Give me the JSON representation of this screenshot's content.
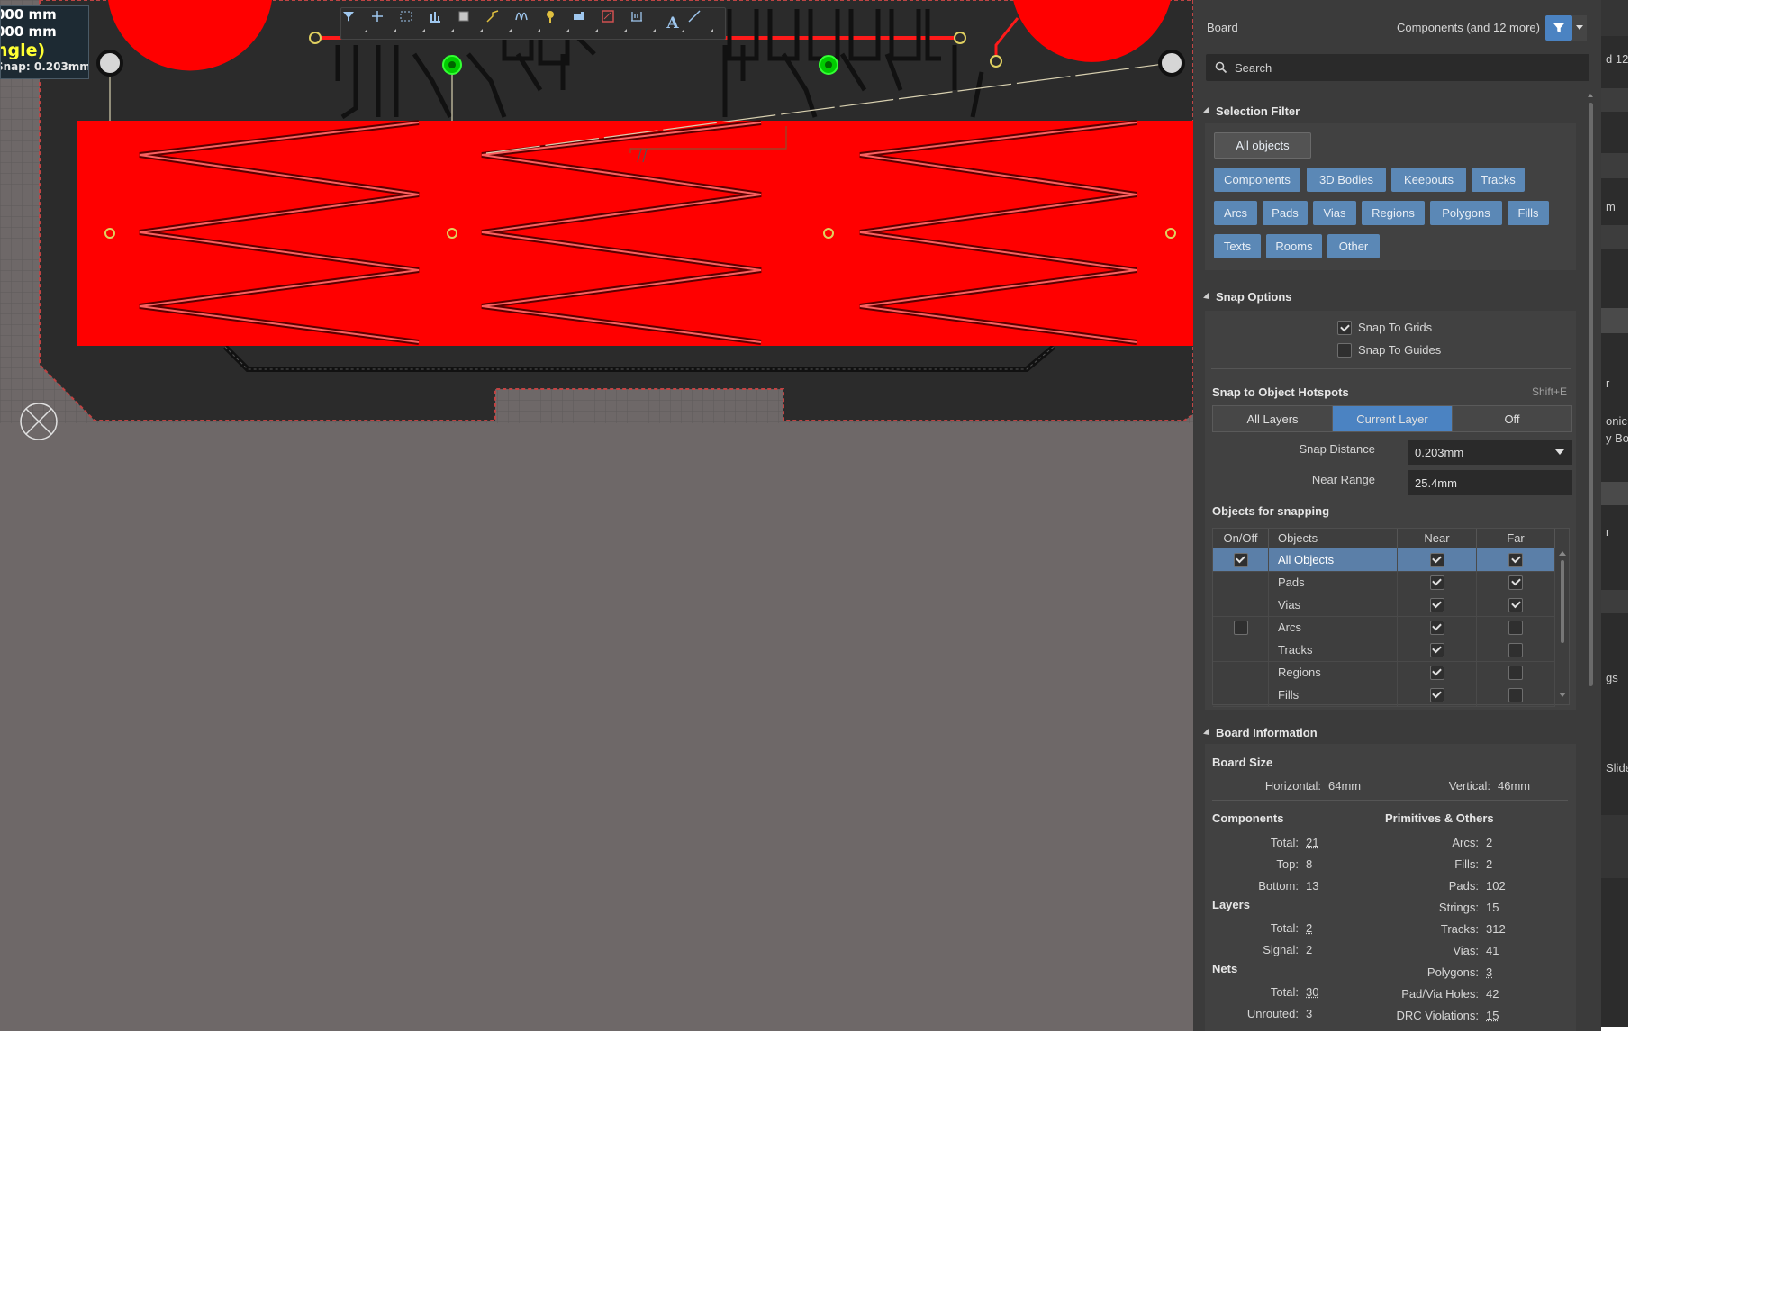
{
  "hud": {
    "line1": "000 mm",
    "line2": "000 mm",
    "line3": "ngle)",
    "snap": "Snap: 0.203mm"
  },
  "toolbar": {
    "tools": [
      "filter-icon",
      "cross-icon",
      "select-rect-icon",
      "align-icon",
      "component-icon",
      "route-icon",
      "tune-icon",
      "pin-icon",
      "fill-icon",
      "polygon-icon",
      "dimension-icon",
      "text-icon",
      "line-icon"
    ],
    "text_tool_glyph": "A"
  },
  "panel": {
    "title": "Board",
    "filter_summary": "Components (and 12 more)",
    "search_placeholder": "Search",
    "selection_filter": {
      "title": "Selection Filter",
      "all_label": "All objects",
      "chips": [
        "Components",
        "3D Bodies",
        "Keepouts",
        "Tracks",
        "Arcs",
        "Pads",
        "Vias",
        "Regions",
        "Polygons",
        "Fills",
        "Texts",
        "Rooms",
        "Other"
      ]
    },
    "snap_options": {
      "title": "Snap Options",
      "snap_to_grids": "Snap To Grids",
      "snap_to_grids_checked": true,
      "snap_to_guides": "Snap To Guides",
      "snap_to_guides_checked": false,
      "hotspots_title": "Snap to Object Hotspots",
      "hotspots_shortcut": "Shift+E",
      "layers_options": [
        "All Layers",
        "Current Layer",
        "Off"
      ],
      "layers_selected": "Current Layer",
      "snap_distance_label": "Snap Distance",
      "snap_distance_value": "0.203mm",
      "near_range_label": "Near Range",
      "near_range_value": "25.4mm",
      "objects_title": "Objects for snapping",
      "columns": [
        "On/Off",
        "Objects",
        "Near",
        "Far"
      ],
      "rows": [
        {
          "name": "All Objects",
          "on": true,
          "near": true,
          "far": true,
          "selected": true
        },
        {
          "name": "Pads",
          "on": null,
          "near": true,
          "far": true
        },
        {
          "name": "Vias",
          "on": null,
          "near": true,
          "far": true
        },
        {
          "name": "Arcs",
          "on": false,
          "near": true,
          "far": false
        },
        {
          "name": "Tracks",
          "on": null,
          "near": true,
          "far": false
        },
        {
          "name": "Regions",
          "on": null,
          "near": true,
          "far": false
        },
        {
          "name": "Fills",
          "on": null,
          "near": true,
          "far": false
        }
      ]
    },
    "board_info": {
      "title": "Board Information",
      "board_size_title": "Board Size",
      "horizontal_label": "Horizontal:",
      "horizontal_value": "64mm",
      "vertical_label": "Vertical:",
      "vertical_value": "46mm",
      "components_title": "Components",
      "components": [
        {
          "label": "Total:",
          "value": "21",
          "link": true
        },
        {
          "label": "Top:",
          "value": "8",
          "link": false
        },
        {
          "label": "Bottom:",
          "value": "13",
          "link": false
        }
      ],
      "layers_title": "Layers",
      "layers": [
        {
          "label": "Total:",
          "value": "2",
          "link": true
        },
        {
          "label": "Signal:",
          "value": "2",
          "link": false
        }
      ],
      "nets_title": "Nets",
      "nets": [
        {
          "label": "Total:",
          "value": "30",
          "link": true
        },
        {
          "label": "Unrouted:",
          "value": "3",
          "link": false
        }
      ],
      "primitives_title": "Primitives & Others",
      "primitives": [
        {
          "label": "Arcs:",
          "value": "2",
          "link": false
        },
        {
          "label": "Fills:",
          "value": "2",
          "link": false
        },
        {
          "label": "Pads:",
          "value": "102",
          "link": false
        },
        {
          "label": "Strings:",
          "value": "15",
          "link": false
        },
        {
          "label": "Tracks:",
          "value": "312",
          "link": false
        },
        {
          "label": "Vias:",
          "value": "41",
          "link": false
        },
        {
          "label": "Polygons:",
          "value": "3",
          "link": true
        },
        {
          "label": "Pad/Via Holes:",
          "value": "42",
          "link": false
        },
        {
          "label": "DRC Violations:",
          "value": "15",
          "link": true
        }
      ]
    }
  },
  "right_strip": {
    "fragments": [
      "d 12",
      "m",
      "r",
      "onic",
      "y Bo",
      "r",
      "gs",
      "Slide"
    ]
  },
  "colors": {
    "canvas_bg": "#6e6868",
    "board_dark": "#2b2b2b",
    "copper_red": "#ff0000",
    "panel_bg": "#3b3b3b",
    "accent_blue": "#4b83c2",
    "chip_blue": "#5b88b6",
    "via_green": "#22dd22"
  }
}
